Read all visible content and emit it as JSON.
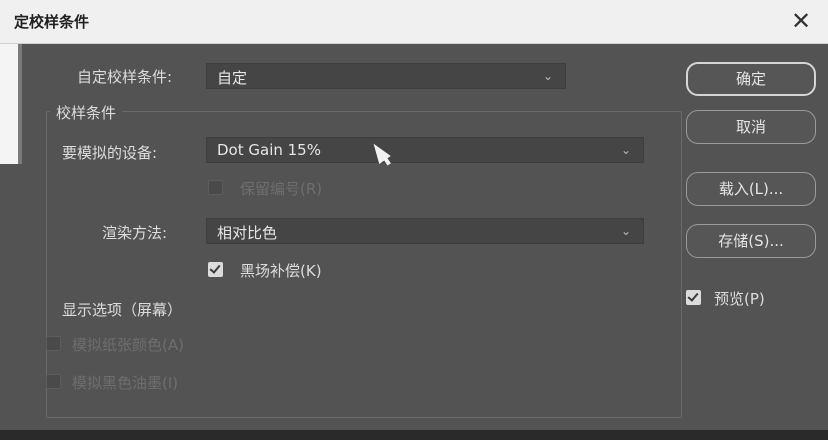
{
  "window": {
    "title": "定校样条件",
    "close_glyph": "✕"
  },
  "custom_condition": {
    "label": "自定校样条件:",
    "value": "自定"
  },
  "proof_conditions": {
    "group_title": "校样条件",
    "device_label": "要模拟的设备:",
    "device_value": "Dot Gain 15%",
    "preserve_numbers_label": "保留编号(R)",
    "preserve_numbers_checked": false,
    "intent_label": "渲染方法:",
    "intent_value": "相对比色",
    "black_point_label": "黑场补偿(K)",
    "black_point_checked": true
  },
  "display_options": {
    "title": "显示选项（屏幕）",
    "simulate_paper_label": "模拟纸张颜色(A)",
    "simulate_paper_checked": false,
    "simulate_black_label": "模拟黑色油墨(I)",
    "simulate_black_checked": false
  },
  "buttons": {
    "ok": "确定",
    "cancel": "取消",
    "load": "载入(L)...",
    "save": "存储(S)..."
  },
  "preview": {
    "label": "预览(P)",
    "checked": true
  },
  "chevron_glyph": "⌄"
}
